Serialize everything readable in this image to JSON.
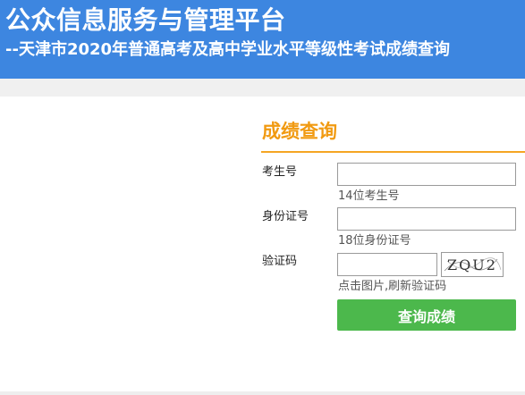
{
  "header": {
    "title": "公众信息服务与管理平台",
    "subtitle": "--天津市2020年普通高考及高中学业水平等级性考试成绩查询"
  },
  "form": {
    "heading": "成绩查询",
    "exam_number": {
      "label": "考生号",
      "value": "",
      "hint": "14位考生号"
    },
    "id_number": {
      "label": "身份证号",
      "value": "",
      "hint": "18位身份证号"
    },
    "captcha": {
      "label": "验证码",
      "value": "",
      "image_text": "ZQU2",
      "hint": "点击图片,刷新验证码"
    },
    "submit_label": "查询成绩"
  },
  "colors": {
    "header_background": "#3d86e0",
    "heading_accent": "#f19a11",
    "submit_button": "#4cb84c"
  }
}
